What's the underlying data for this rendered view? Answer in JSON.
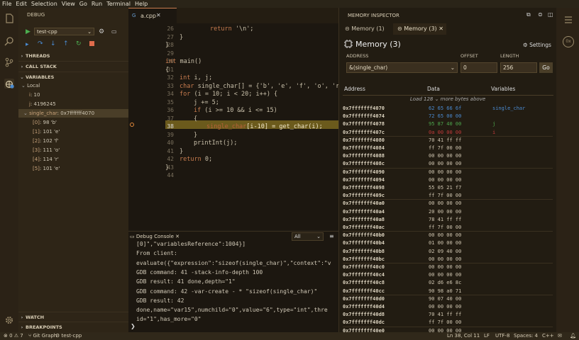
{
  "menu": [
    "File",
    "Edit",
    "Selection",
    "View",
    "Go",
    "Run",
    "Terminal",
    "Help"
  ],
  "sidebar": {
    "title": "DEBUG",
    "config": "test-cpp",
    "sections": {
      "threads": "THREADS",
      "callstack": "CALL STACK",
      "variables": "VARIABLES",
      "watch": "WATCH",
      "breakpoints": "BREAKPOINTS"
    },
    "local_label": "Local",
    "vars": [
      {
        "name": "i",
        "value": "10"
      },
      {
        "name": "j",
        "value": "4196245"
      }
    ],
    "single_char": {
      "name": "single_char",
      "value": "0x7fffffff4070"
    },
    "elements": [
      {
        "idx": "[0]",
        "val": "98 'b'"
      },
      {
        "idx": "[1]",
        "val": "101 'e'"
      },
      {
        "idx": "[2]",
        "val": "102 'f'"
      },
      {
        "idx": "[3]",
        "val": "111 'o'"
      },
      {
        "idx": "[4]",
        "val": "114 'r'"
      },
      {
        "idx": "[5]",
        "val": "101 'e'"
      }
    ]
  },
  "editor": {
    "tab": "a.cpp",
    "lines": [
      "26",
      "27",
      "28",
      "29",
      "30",
      "31",
      "32",
      "33",
      "34",
      "35",
      "36",
      "37",
      "38",
      "39",
      "40",
      "41",
      "42",
      "43",
      "44"
    ],
    "code": {
      "l26a": "return",
      "l26b": " '\\n';",
      "l27": "}",
      "l28": "}",
      "l30a": "int",
      "l30b": " main()",
      "l31": "{",
      "l32a": "int",
      "l32b": " i, j;",
      "l33a": "char",
      "l33b": " single_char[] = {'b', 'e', 'f', 'o', 'r",
      "l34a": "for",
      "l34b": " (i = 10; i < 20; i++) {",
      "l35": "j += 5;",
      "l36a": "if",
      "l36b": " (i >= 10 && i <= 15)",
      "l37": "{",
      "l38a": "single_char",
      "l38b": "[i-10] = get_char(i);",
      "l39": "}",
      "l40": "printInt(j);",
      "l41": "}",
      "l42a": "return",
      "l42b": " 0;",
      "l43": "}"
    }
  },
  "console": {
    "tab": "Debug Console",
    "filter": "All",
    "lines": [
      "[0]\",\"variablesReference\":1004}]",
      "From client:",
      "evaluate({\"expression\":\"sizeof(single_char)\",\"context\":\"v",
      "GDB command: 41 -stack-info-depth 100",
      "GDB result: 41 done,depth=\"1\"",
      "GDB command: 42 -var-create - * \"sizeof(single_char)\"",
      "GDB result: 42",
      "done,name=\"var15\",numchild=\"0\",value=\"6\",type=\"int\",thre",
      "id=\"1\",has_more=\"0\""
    ],
    "prompt": "❯"
  },
  "memory": {
    "title": "MEMORY INSPECTOR",
    "tabs": [
      "Memory (1)",
      "Memory (3)"
    ],
    "heading": "Memory (3)",
    "settings": "Settings",
    "address_label": "ADDRESS",
    "offset_label": "OFFSET",
    "length_label": "LENGTH",
    "address_value": "&(single_char)",
    "offset_value": "0",
    "length_value": "256",
    "go_label": "Go",
    "col_address": "Address",
    "col_data": "Data",
    "col_variables": "Variables",
    "load_more": "Load 128 ⌄ more bytes above",
    "rows": [
      {
        "addr": "0x7fffffff4070",
        "data": "62 65 66 6f",
        "var": "single_char",
        "color": "#4a8ad0"
      },
      {
        "addr": "0x7fffffff4074",
        "data": "72 65 00 00",
        "var": "",
        "color": "#4a8ad0"
      },
      {
        "addr": "0x7fffffff4078",
        "data": "95 87 40 00",
        "var": "j",
        "color": "#4ca64c"
      },
      {
        "addr": "0x7fffffff407c",
        "data": "0a 00 00 00",
        "var": "i",
        "color": "#c03a3a"
      },
      {
        "addr": "0x7fffffff4080",
        "data": "70 41 ff ff",
        "var": "",
        "color": ""
      },
      {
        "addr": "0x7fffffff4084",
        "data": "ff 7f 00 00",
        "var": "",
        "color": ""
      },
      {
        "addr": "0x7fffffff4088",
        "data": "00 00 00 00",
        "var": "",
        "color": ""
      },
      {
        "addr": "0x7fffffff408c",
        "data": "00 00 00 00",
        "var": "",
        "color": ""
      },
      {
        "addr": "0x7fffffff4090",
        "data": "00 00 00 00",
        "var": "",
        "color": ""
      },
      {
        "addr": "0x7fffffff4094",
        "data": "00 00 00 00",
        "var": "",
        "color": ""
      },
      {
        "addr": "0x7fffffff4098",
        "data": "55 05 21 f7",
        "var": "",
        "color": ""
      },
      {
        "addr": "0x7fffffff409c",
        "data": "ff 7f 00 00",
        "var": "",
        "color": ""
      },
      {
        "addr": "0x7fffffff40a0",
        "data": "00 00 00 00",
        "var": "",
        "color": ""
      },
      {
        "addr": "0x7fffffff40a4",
        "data": "20 00 00 00",
        "var": "",
        "color": ""
      },
      {
        "addr": "0x7fffffff40a8",
        "data": "78 41 ff ff",
        "var": "",
        "color": ""
      },
      {
        "addr": "0x7fffffff40ac",
        "data": "ff 7f 00 00",
        "var": "",
        "color": ""
      },
      {
        "addr": "0x7fffffff40b0",
        "data": "00 00 00 00",
        "var": "",
        "color": ""
      },
      {
        "addr": "0x7fffffff40b4",
        "data": "01 00 00 00",
        "var": "",
        "color": ""
      },
      {
        "addr": "0x7fffffff40b8",
        "data": "02 09 40 00",
        "var": "",
        "color": ""
      },
      {
        "addr": "0x7fffffff40bc",
        "data": "00 00 00 00",
        "var": "",
        "color": ""
      },
      {
        "addr": "0x7fffffff40c0",
        "data": "00 00 00 00",
        "var": "",
        "color": ""
      },
      {
        "addr": "0x7fffffff40c4",
        "data": "00 00 00 00",
        "var": "",
        "color": ""
      },
      {
        "addr": "0x7fffffff40c8",
        "data": "02 d6 e6 8c",
        "var": "",
        "color": ""
      },
      {
        "addr": "0x7fffffff40cc",
        "data": "90 98 a0 71",
        "var": "",
        "color": ""
      },
      {
        "addr": "0x7fffffff40d0",
        "data": "90 07 40 00",
        "var": "",
        "color": ""
      },
      {
        "addr": "0x7fffffff40d4",
        "data": "00 00 00 00",
        "var": "",
        "color": ""
      },
      {
        "addr": "0x7fffffff40d8",
        "data": "70 41 ff ff",
        "var": "",
        "color": ""
      },
      {
        "addr": "0x7fffffff40dc",
        "data": "ff 7f 00 00",
        "var": "",
        "color": ""
      },
      {
        "addr": "0x7fffffff40e0",
        "data": "00 00 00 00",
        "var": "",
        "color": ""
      }
    ]
  },
  "status": {
    "problems": "⊗ 0 ⚠ 7",
    "git": "Git Graph",
    "debug": "test-cpp",
    "position": "Ln 38, Col 11",
    "eol": "LF",
    "encoding": "UTF-8",
    "spaces": "Spaces: 4",
    "lang": "C++"
  }
}
